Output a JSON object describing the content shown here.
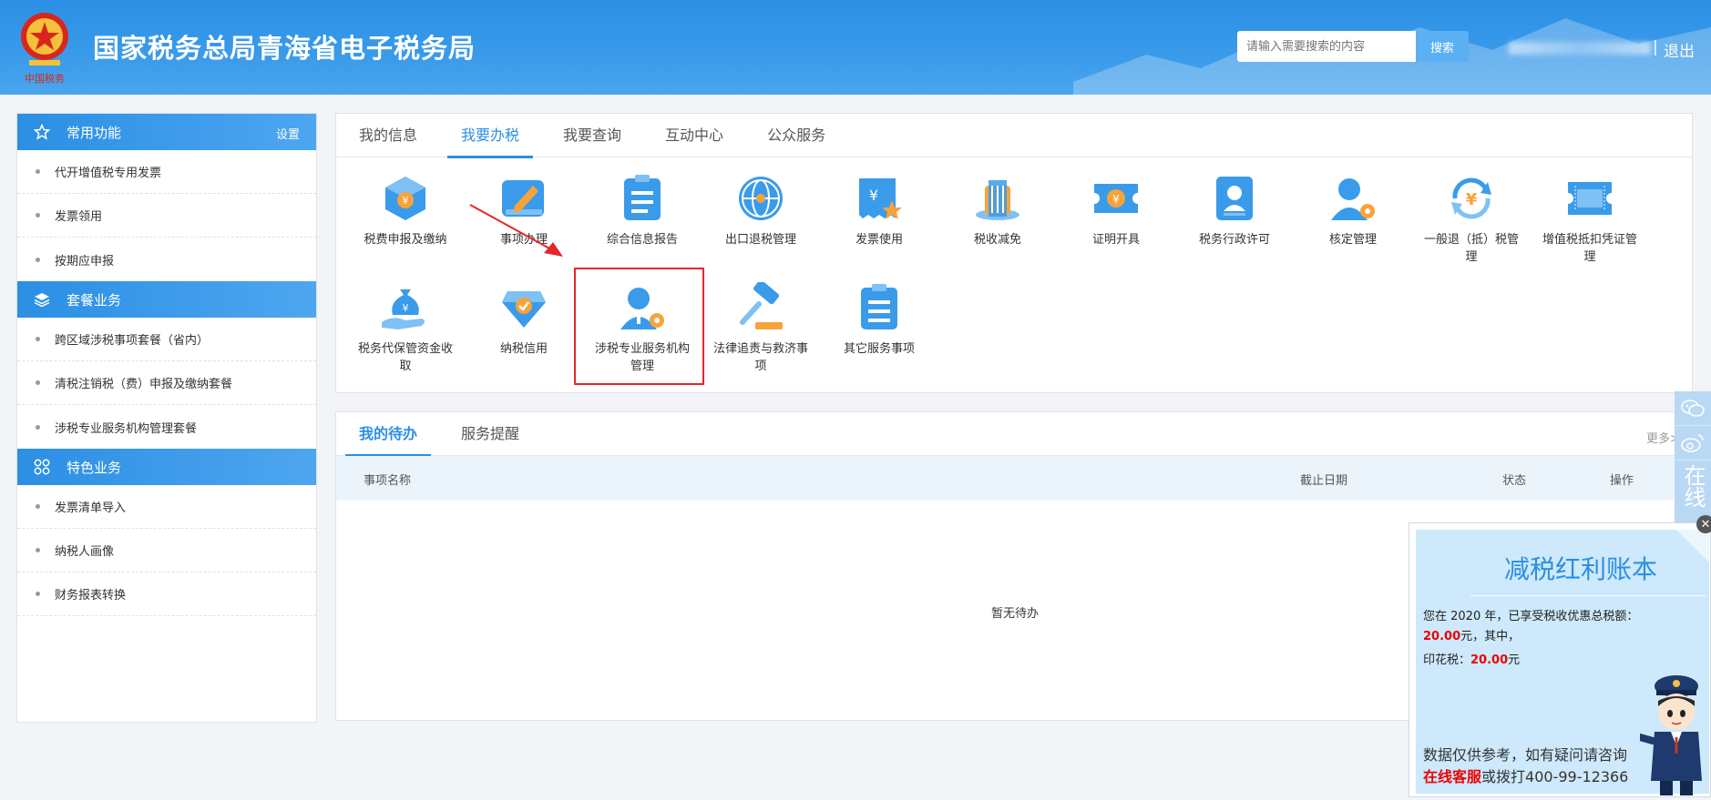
{
  "header": {
    "title": "国家税务总局青海省电子税务局",
    "search_placeholder": "请输入需要搜索的内容",
    "search_label": "搜索",
    "separator": "|",
    "logout_label": "退出"
  },
  "sidebar": {
    "groups": [
      {
        "title": "常用功能",
        "setting": "设置",
        "items": [
          "代开增值税专用发票",
          "发票领用",
          "按期应申报"
        ]
      },
      {
        "title": "套餐业务",
        "items": [
          "跨区域涉税事项套餐（省内）",
          "清税注销税（费）申报及缴纳套餐",
          "涉税专业服务机构管理套餐"
        ]
      },
      {
        "title": "特色业务",
        "items": [
          "发票清单导入",
          "纳税人画像",
          "财务报表转换"
        ]
      }
    ]
  },
  "main": {
    "tabs": [
      "我的信息",
      "我要办税",
      "我要查询",
      "互动中心",
      "公众服务"
    ],
    "active_tab": 1,
    "tiles": [
      {
        "label": "税费申报及缴纳",
        "icon": "box-yuan-icon"
      },
      {
        "label": "事项办理",
        "icon": "edit-pen-icon"
      },
      {
        "label": "综合信息报告",
        "icon": "clipboard-icon"
      },
      {
        "label": "出口退税管理",
        "icon": "globe-icon"
      },
      {
        "label": "发票使用",
        "icon": "invoice-star-icon"
      },
      {
        "label": "税收减免",
        "icon": "coins-icon"
      },
      {
        "label": "证明开具",
        "icon": "ticket-yuan-icon"
      },
      {
        "label": "税务行政许可",
        "icon": "id-badge-icon"
      },
      {
        "label": "核定管理",
        "icon": "person-gear-icon"
      },
      {
        "label": "一般退（抵）税管理",
        "icon": "refund-cycle-icon"
      },
      {
        "label": "增值税抵扣凭证管理",
        "icon": "vat-ticket-icon"
      },
      {
        "label": "税务代保管资金收取",
        "icon": "money-bag-hand-icon"
      },
      {
        "label": "纳税信用",
        "icon": "credit-diamond-icon"
      },
      {
        "label": "涉税专业服务机构管理",
        "icon": "agent-gear-icon"
      },
      {
        "label": "法律追责与救济事项",
        "icon": "gavel-icon"
      },
      {
        "label": "其它服务事项",
        "icon": "list-doc-icon"
      }
    ]
  },
  "todo": {
    "tabs": [
      "我的待办",
      "服务提醒"
    ],
    "more": "更多>",
    "columns": [
      "事项名称",
      "截止日期",
      "状态",
      "操作"
    ],
    "empty_text": "暂无待办"
  },
  "float_bar": {
    "online_label": "在线"
  },
  "popup": {
    "title": "减税红利账本",
    "line1": "您在 2020 年，已享受税收优惠总税额：",
    "amount_total": "20.00",
    "line2_suffix": "元，其中，",
    "stamp_label": "印花税：",
    "stamp_amount": "20.00",
    "stamp_suffix": "元",
    "footer1": "数据仅供参考，如有疑问请咨询",
    "footer_link": "在线客服",
    "footer2": "或拨打400-99-12366",
    "close": "✕"
  },
  "colors": {
    "brand_blue": "#2b8fe4",
    "highlight_red": "#e4262b",
    "icon_orange": "#f7a33b"
  }
}
